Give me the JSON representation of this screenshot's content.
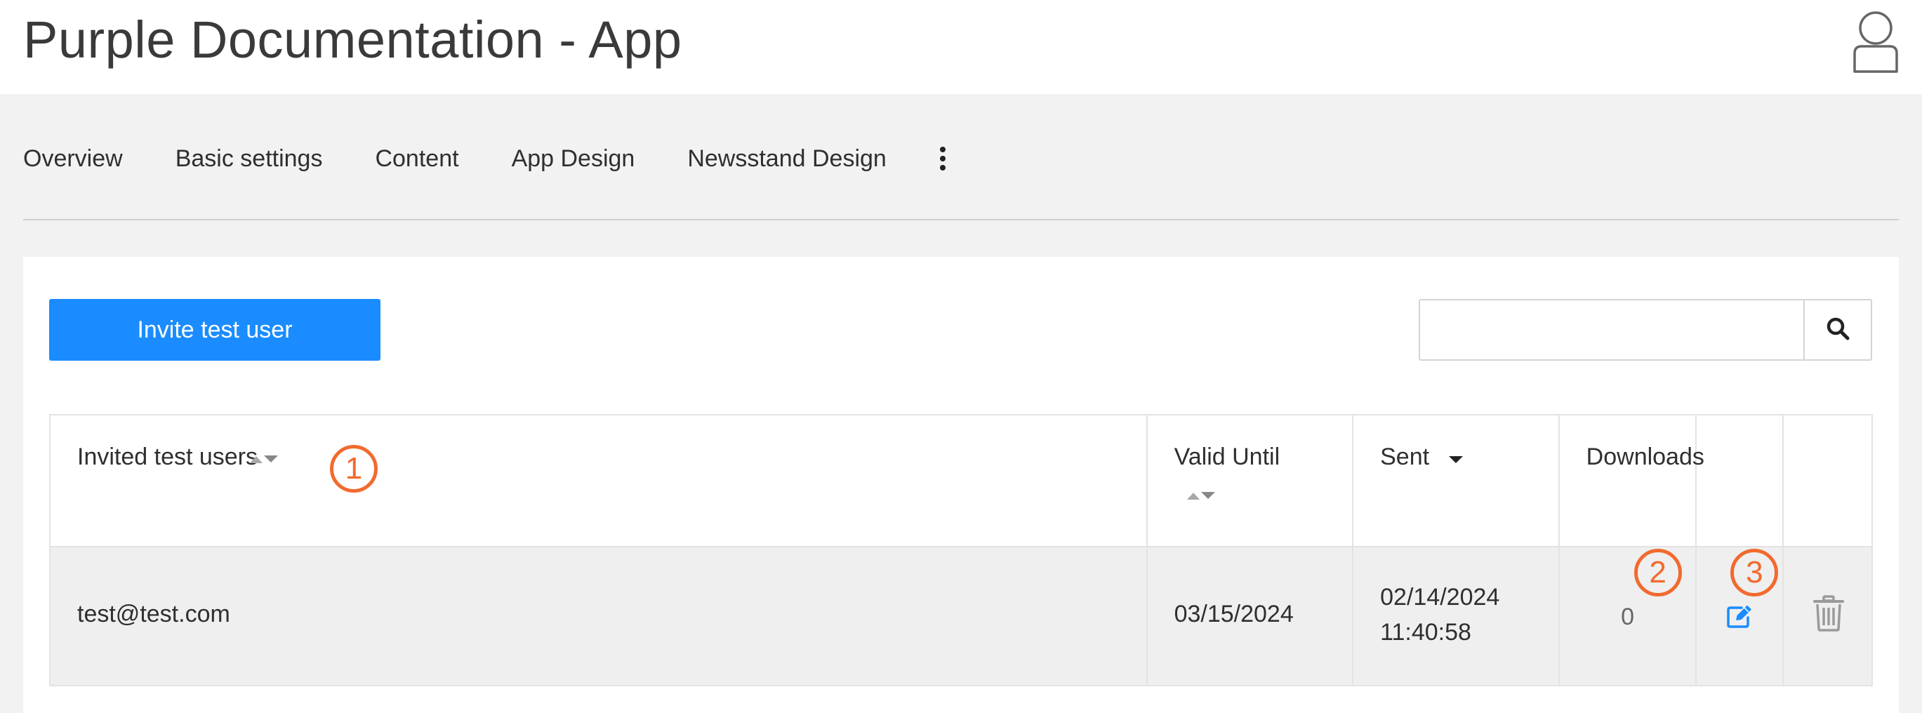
{
  "header": {
    "title": "Purple Documentation - App",
    "user_icon": "user-avatar-icon"
  },
  "nav": {
    "tabs": [
      {
        "label": "Overview"
      },
      {
        "label": "Basic settings"
      },
      {
        "label": "Content"
      },
      {
        "label": "App Design"
      },
      {
        "label": "Newsstand Design"
      }
    ],
    "more_icon": "vertical-ellipsis-icon"
  },
  "toolbar": {
    "invite_label": "Invite test user",
    "search_value": "",
    "search_placeholder": "",
    "search_icon": "search-icon"
  },
  "table": {
    "headers": {
      "invited": "Invited test users",
      "valid_until": "Valid Until",
      "sent": "Sent",
      "downloads": "Downloads"
    },
    "rows": [
      {
        "email": "test@test.com",
        "valid_until": "03/15/2024",
        "sent_date": "02/14/2024",
        "sent_time": "11:40:58",
        "downloads": "0",
        "edit_icon": "edit-icon",
        "delete_icon": "trash-icon"
      }
    ]
  },
  "annotations": {
    "m1": "1",
    "m2": "2",
    "m3": "3"
  },
  "colors": {
    "accent": "#1a8cff",
    "marker": "#f26a2e",
    "edit_icon": "#1a8cff",
    "delete_icon": "#9a9a9a"
  }
}
